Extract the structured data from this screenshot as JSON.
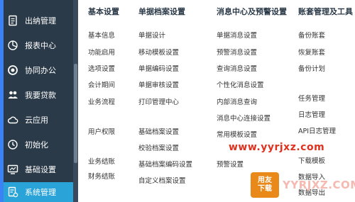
{
  "sidebar": {
    "items": [
      {
        "label": "出纳管理",
        "icon": "document-icon"
      },
      {
        "label": "报表中心",
        "icon": "pie-chart-icon"
      },
      {
        "label": "协同办公",
        "icon": "target-icon"
      },
      {
        "label": "我要贷款",
        "icon": "people-icon"
      },
      {
        "label": "云应用",
        "icon": "cloud-icon"
      },
      {
        "label": "初始化",
        "icon": "clock-icon"
      },
      {
        "label": "基础设置",
        "icon": "monitor-icon"
      },
      {
        "label": "系统管理",
        "icon": "document-gear-icon",
        "active": true
      }
    ]
  },
  "menu": {
    "columns": [
      {
        "title": "基本设置",
        "items": [
          "基本信息",
          "功能启用",
          "选项设置",
          "会计期间",
          "业务流程",
          "用户权限",
          "业务结账",
          "财务结账"
        ]
      },
      {
        "title": "单据档案设置",
        "items": [
          "单据设计",
          "移动模板设置",
          "单据编码设置",
          "单据审核设置",
          "打印管理中心",
          "基础档案设置",
          "校验档案设置",
          "基础档案编码设置",
          "自定义档案设置"
        ]
      },
      {
        "title": "消息中心及预警设置",
        "items": [
          "单据消息设置",
          "预警消息设置",
          "查询消息设置",
          "个性化消息设置",
          "内部消息查询",
          "消息中心连接设置",
          "常用模板设置",
          "预警设置"
        ]
      },
      {
        "title": "账套管理及工具",
        "items": [
          "备份账套",
          "恢复账套",
          "备份计划",
          "任务管理",
          "日志管理",
          "API日志管理",
          "下载模板",
          "数据导入",
          "数据导出"
        ]
      }
    ]
  },
  "watermark": {
    "site": "www.yyrjxz.com",
    "badge_line1": "用友",
    "badge_line2": "下载",
    "brand": "YYRJXZ.COM"
  },
  "colors": {
    "sidebar_bg": "#2b3a48",
    "active_bg": "#2aa4d8",
    "watermark_red": "#e0301e"
  }
}
